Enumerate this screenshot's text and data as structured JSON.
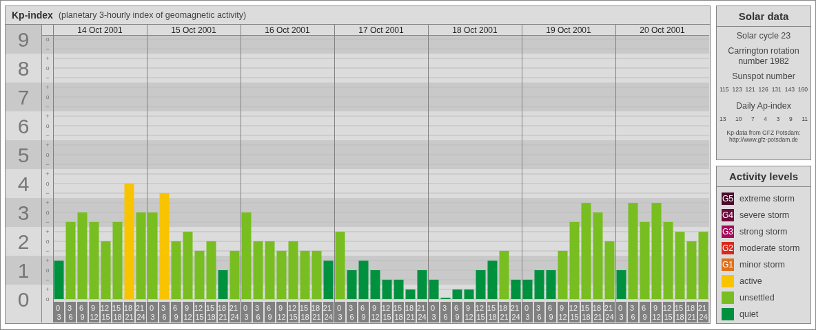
{
  "kp_panel": {
    "title": "Kp-index",
    "subtitle": "(planetary 3-hourly index of geomagnetic activity)",
    "sub_levels": [
      "o",
      "−",
      "+",
      "o",
      "−",
      "+",
      "o",
      "−",
      "+",
      "o",
      "−",
      "+",
      "o",
      "−",
      "+",
      "o",
      "−",
      "+",
      "o",
      "−",
      "+",
      "o",
      "−",
      "+",
      "o",
      "−",
      "+",
      "o"
    ],
    "dates": [
      "14 Oct 2001",
      "15 Oct 2001",
      "16 Oct 2001",
      "17 Oct 2001",
      "18 Oct 2001",
      "19 Oct 2001",
      "20 Oct 2001"
    ],
    "chart_data": {
      "type": "bar",
      "grid": true,
      "ylim": [
        0,
        9
      ],
      "yticks": [
        {
          "value": 0,
          "label": "0"
        },
        {
          "value": 1,
          "label": "1"
        },
        {
          "value": 2,
          "label": "2"
        },
        {
          "value": 3,
          "label": "3"
        },
        {
          "value": 4,
          "label": "4"
        },
        {
          "value": 5,
          "label": "5"
        },
        {
          "value": 6,
          "label": "6"
        },
        {
          "value": 7,
          "label": "7"
        },
        {
          "value": 8,
          "label": "8"
        },
        {
          "value": 9,
          "label": "9"
        }
      ],
      "categories": [
        "0 3",
        "3 6",
        "6 9",
        "9 12",
        "12 15",
        "15 18",
        "18 21",
        "21 24",
        "0 3",
        "3 6",
        "6 9",
        "9 12",
        "12 15",
        "15 18",
        "18 21",
        "21 24",
        "0 3",
        "3 6",
        "6 9",
        "9 12",
        "12 15",
        "15 18",
        "18 21",
        "21 24",
        "0 3",
        "3 6",
        "6 9",
        "9 12",
        "12 15",
        "15 18",
        "18 21",
        "21 24",
        "0 3",
        "3 6",
        "6 9",
        "9 12",
        "12 15",
        "15 18",
        "18 21",
        "21 24",
        "0 3",
        "3 6",
        "6 9",
        "9 12",
        "12 15",
        "15 18",
        "18 21",
        "21 24",
        "0 3",
        "3 6",
        "6 9",
        "9 12",
        "12 15",
        "15 18",
        "18 21",
        "21 24"
      ],
      "series": [
        {
          "name": "active",
          "color": "#f8c400",
          "values": [
            null,
            null,
            null,
            null,
            null,
            null,
            4,
            null,
            null,
            3.67,
            null,
            null,
            null,
            null,
            null,
            null,
            null,
            null,
            null,
            null,
            null,
            null,
            null,
            null,
            null,
            null,
            null,
            null,
            null,
            null,
            null,
            null,
            null,
            null,
            null,
            null,
            null,
            null,
            null,
            null,
            null,
            null,
            null,
            null,
            null,
            null,
            null,
            null,
            null,
            null,
            null,
            null,
            null,
            null,
            null,
            null
          ]
        },
        {
          "name": "unsettled",
          "color": "#78be20",
          "values": [
            null,
            2.67,
            3,
            2.67,
            2,
            2.67,
            null,
            3,
            3,
            null,
            2,
            2.33,
            1.67,
            2,
            null,
            1.67,
            3,
            2,
            2,
            1.67,
            2,
            1.67,
            1.67,
            null,
            2.33,
            null,
            null,
            null,
            null,
            null,
            null,
            null,
            null,
            null,
            null,
            null,
            null,
            null,
            1.67,
            null,
            null,
            null,
            null,
            1.67,
            2.67,
            3.33,
            3,
            2,
            null,
            3.33,
            2.67,
            3.33,
            2.67,
            2.33,
            2,
            2.33
          ]
        },
        {
          "name": "quiet",
          "color": "#00913f",
          "values": [
            1.33,
            null,
            null,
            null,
            null,
            null,
            null,
            null,
            null,
            null,
            null,
            null,
            null,
            null,
            1,
            null,
            null,
            null,
            null,
            null,
            null,
            null,
            null,
            1.33,
            null,
            1,
            1.33,
            1,
            0.67,
            0.67,
            0.33,
            1,
            0.67,
            0,
            0.33,
            0.33,
            1,
            1.33,
            null,
            0.67,
            0.67,
            1,
            1,
            null,
            null,
            null,
            null,
            null,
            1,
            null,
            null,
            null,
            null,
            null,
            null,
            null
          ]
        }
      ]
    }
  },
  "solar_data": {
    "title": "Solar data",
    "cycle": "Solar cycle 23",
    "carrington": "Carrington rotation number 1982",
    "sunspot_label": "Sunspot number",
    "sunspot_numbers": [
      "115",
      "123",
      "121",
      "126",
      "131",
      "143",
      "160"
    ],
    "ap_label": "Daily Ap-index",
    "ap_values": [
      "13",
      "10",
      "7",
      "4",
      "3",
      "9",
      "11"
    ],
    "credit_lines": [
      "Kp-data from GFZ Potsdam:",
      "http://www.gfz-potsdam.de"
    ]
  },
  "activity_levels": {
    "title": "Activity levels",
    "items": [
      {
        "badge": "G5",
        "label": "extreme storm",
        "color": "#4a0a2c"
      },
      {
        "badge": "G4",
        "label": "severe storm",
        "color": "#6e0a3c"
      },
      {
        "badge": "G3",
        "label": "strong storm",
        "color": "#a50a5a"
      },
      {
        "badge": "G2",
        "label": "moderate storm",
        "color": "#d82a1a"
      },
      {
        "badge": "G1",
        "label": "minor storm",
        "color": "#e0701a"
      }
    ]
  }
}
